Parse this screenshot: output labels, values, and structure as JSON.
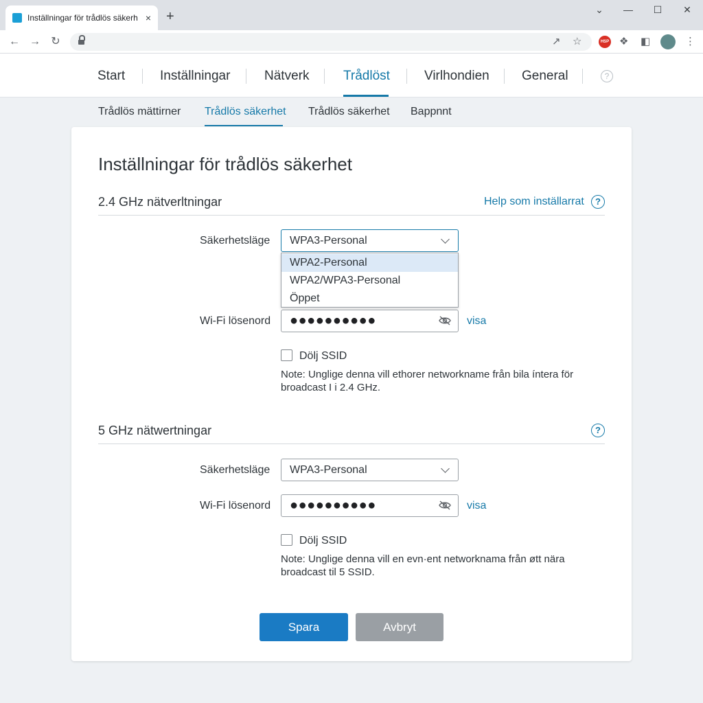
{
  "browser": {
    "tab_title": "Inställningar för trådlös säkerh",
    "new_tab": "+",
    "close": "×",
    "window_controls": {
      "minimize": "—",
      "maximize": "☐",
      "close": "✕",
      "dropdown": "⌄"
    },
    "extension_badge": "HSP"
  },
  "topnav": {
    "items": [
      {
        "label": "Start"
      },
      {
        "label": "Inställningar"
      },
      {
        "label": "Nätverk"
      },
      {
        "label": "Trådlöst"
      },
      {
        "label": "Virlhondien"
      },
      {
        "label": "General"
      }
    ],
    "active_index": 3,
    "help": "?"
  },
  "subnav": {
    "items": [
      {
        "label": "Trådlös mättirner"
      },
      {
        "label": "Trådlös säkerhet"
      },
      {
        "label": "Trådlös säkerhet"
      },
      {
        "label": "Bappnnt"
      }
    ],
    "active_index": 1
  },
  "page": {
    "title": "Inställningar för trådlös säkerhet"
  },
  "band24": {
    "title": "2.4 GHz nätverltningar",
    "help_link": "Help som inställarrat",
    "help_icon": "?",
    "security_label": "Säkerhetsläge",
    "security_value": "WPA3-Personal",
    "dropdown_options": [
      "WPA2-Personal",
      "WPA2/WPA3-Personal",
      "Öppet"
    ],
    "highlighted_option": 0,
    "password_label": "Wi-Fi lösenord",
    "password_value": "●●●●●●●●●●",
    "show_label": "visa",
    "hide_ssid_label": "Dölj SSID",
    "hide_ssid_checked": false,
    "note_line1": "Note: Unglige denna vill ethorer networkname från bila íntera för",
    "note_line2": "broadcast I i 2.4 GHz."
  },
  "band5": {
    "title": "5 GHz nätwertningar",
    "help_icon": "?",
    "security_label": "Säkerhetsläge",
    "security_value": "WPA3-Personal",
    "password_label": "Wi-Fi lösenord",
    "password_value": "●●●●●●●●●●",
    "show_label": "visa",
    "hide_ssid_label": "Dölj SSID",
    "hide_ssid_checked": false,
    "note_line1": "Note: Unglige denna vill en evn·ent networknama från øtt nära",
    "note_line2": "broadcast til 5 SSID."
  },
  "actions": {
    "save": "Spara",
    "cancel": "Avbryt"
  },
  "colors": {
    "accent": "#1579a8",
    "save_button": "#1a7bc4",
    "cancel_button": "#9a9fa4",
    "highlight": "#dce9f7"
  }
}
